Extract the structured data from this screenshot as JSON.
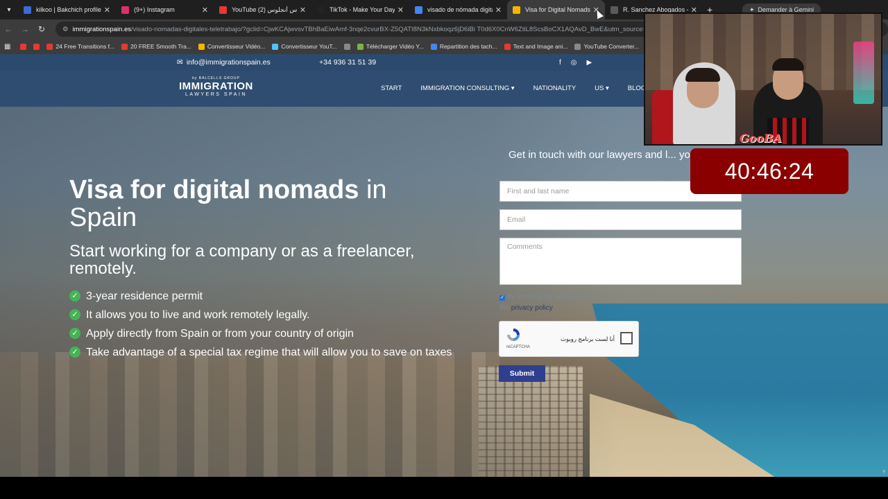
{
  "tabs": [
    {
      "title": "kilkoo | Bakchich profile | I",
      "color": "#3d6ad6"
    },
    {
      "title": "(9+) Instagram",
      "color": "#d6336c"
    },
    {
      "title": "YouTube لوس أنجلوس (2)",
      "color": "#e53935"
    },
    {
      "title": "TikTok - Make Your Day",
      "color": "#222222"
    },
    {
      "title": "visado de nómada digital",
      "color": "#4285f4"
    },
    {
      "title": "Visa for Digital Nomads a",
      "color": "#f4b400",
      "active": true
    },
    {
      "title": "R. Sanchez Abogados - B",
      "color": "#5a5a5a"
    }
  ],
  "gemini_label": "Demander à Gemini",
  "url": {
    "host": "immigrationspain.es",
    "path": "/visado-nomadas-digitales-teletrabajo/?gclid=CjwKCAjwvsvTBhBaEiwAmf-3nqe2cvurBX-Z5QATI8N3kNxbkoqz6jD6iBi T0d6X0CnW6ZtiL8ScsBoCX1AQAvD_BwE&utm_source=google"
  },
  "bookmarks": [
    {
      "label": "",
      "color": "#e53935"
    },
    {
      "label": "",
      "color": "#e53935"
    },
    {
      "label": "24 Free Transitions f...",
      "color": "#e53935"
    },
    {
      "label": "20 FREE Smooth Tra...",
      "color": "#e53935"
    },
    {
      "label": "Convertisseur Vidéo...",
      "color": "#f4b400"
    },
    {
      "label": "Convertisseur YouT...",
      "color": "#4fc3f7"
    },
    {
      "label": "",
      "color": "#888888"
    },
    {
      "label": "Télécharger Vidéo Y...",
      "color": "#7cb342"
    },
    {
      "label": "Repartition des tach...",
      "color": "#4285f4"
    },
    {
      "label": "Text and Image ani...",
      "color": "#e53935"
    },
    {
      "label": "YouTube Converter...",
      "color": "#888888"
    }
  ],
  "site": {
    "email": "info@immigrationspain.es",
    "phone": "+34 936 31 51 39",
    "logo_small": "by BALCELLS GROUP",
    "logo_big": "IMMIGRATION",
    "logo_sub": "LAWYERS SPAIN",
    "menu": [
      "START",
      "IMMIGRATION CONSULTING ▾",
      "NATIONALITY",
      "US ▾",
      "BLOG"
    ],
    "hero_title_bold": "Visa for digital nomads",
    "hero_title_rest": " in Spain",
    "hero_sub": "Start working for a company or as a freelancer, remotely.",
    "bullets": [
      "3-year residence permit",
      "It allows you to live and work remotely legally.",
      "Apply directly from Spain or from your country of origin",
      "Take advantage of a special tax regime that will allow you to save on taxes"
    ]
  },
  "form": {
    "heading": "Get in touch with our lawyers and l... you step by step (fast response g...",
    "name_placeholder": "First and last name",
    "email_placeholder": "Email",
    "comments_placeholder": "Comments",
    "consent_text": "By sending my personal information, I confirm that I have read and accept the",
    "privacy_link": "privacy policy",
    "captcha_label": "أنا لست برنامج روبوت",
    "captcha_brand": "reCAPTCHA",
    "submit": "Submit"
  },
  "overlay": {
    "timer": "40:46:24",
    "signature": "GooBA"
  }
}
